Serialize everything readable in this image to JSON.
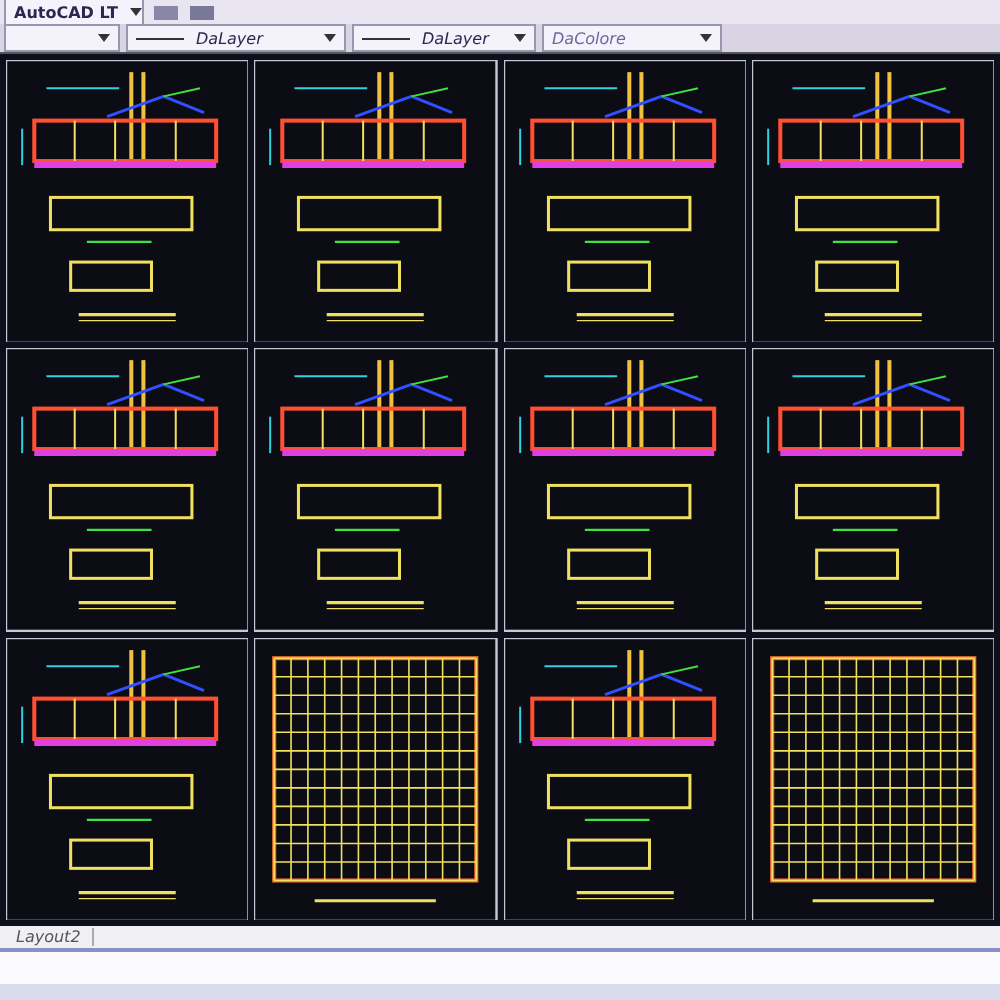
{
  "toolbar": {
    "workspace": {
      "value": "AutoCAD LT"
    },
    "properties": [
      {
        "kind": "blank"
      },
      {
        "kind": "linetype",
        "value": "DaLayer"
      },
      {
        "kind": "lineweight",
        "value": "DaLayer"
      },
      {
        "kind": "color",
        "value": "DaColore"
      }
    ]
  },
  "sheets": [
    {
      "kind": "section"
    },
    {
      "kind": "section"
    },
    {
      "kind": "section"
    },
    {
      "kind": "section"
    },
    {
      "kind": "section"
    },
    {
      "kind": "section"
    },
    {
      "kind": "section"
    },
    {
      "kind": "section"
    },
    {
      "kind": "section"
    },
    {
      "kind": "grid"
    },
    {
      "kind": "section"
    },
    {
      "kind": "grid"
    }
  ],
  "layout_tabs": [
    {
      "label": "Layout2",
      "selected": false
    }
  ]
}
